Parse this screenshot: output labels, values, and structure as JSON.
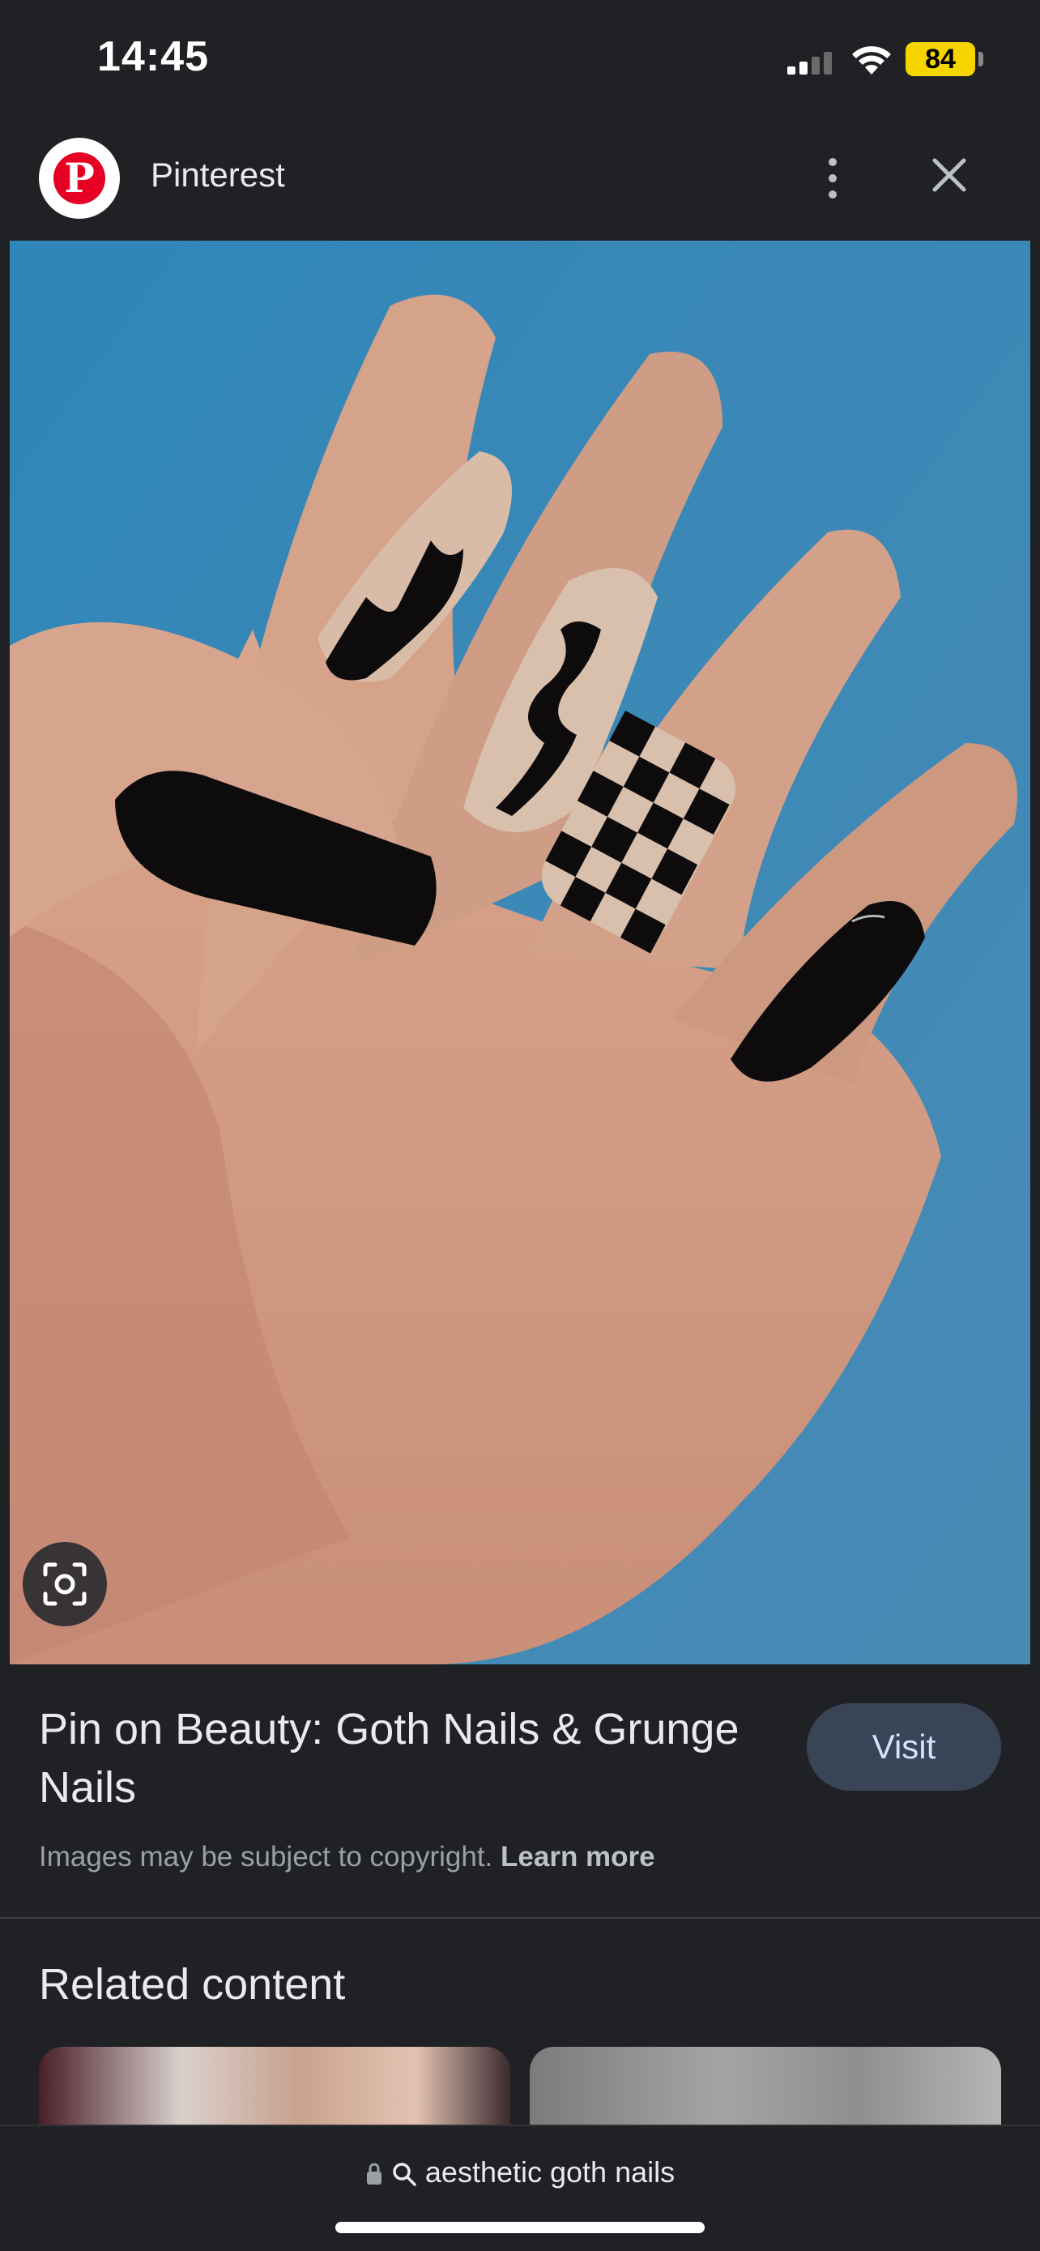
{
  "status_bar": {
    "time": "14:45",
    "battery": "84",
    "battery_color": "#f5d400"
  },
  "header": {
    "site_name": "Pinterest",
    "logo_icon": "pinterest-logo",
    "brand_color": "#e60023"
  },
  "image": {
    "lens_icon": "google-lens-icon"
  },
  "pin": {
    "title": "Pin on Beauty: Goth Nails & Grunge Nails",
    "visit_label": "Visit",
    "copyright_text": "Images may be subject to copyright.",
    "learn_more": "Learn more"
  },
  "related": {
    "title": "Related content"
  },
  "address_bar": {
    "query": "aesthetic goth nails"
  }
}
